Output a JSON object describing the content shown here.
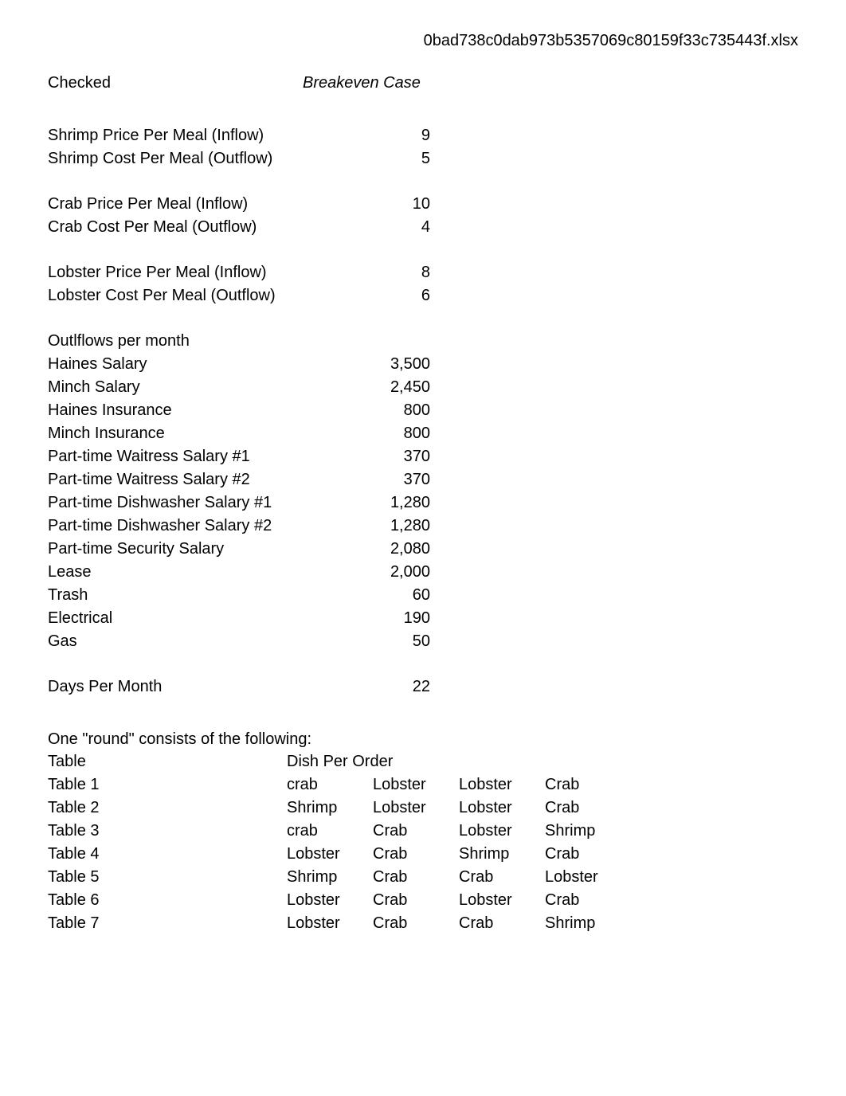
{
  "filename": "0bad738c0dab973b5357069c80159f33c735443f.xlsx",
  "checked_label": "Checked",
  "case_label": "Breakeven Case",
  "pricing_groups": [
    [
      {
        "label": "Shrimp Price Per Meal (Inflow)",
        "value": "9"
      },
      {
        "label": "Shrimp Cost Per Meal (Outflow)",
        "value": "5"
      }
    ],
    [
      {
        "label": "Crab Price Per Meal (Inflow)",
        "value": "10"
      },
      {
        "label": "Crab Cost Per Meal (Outflow)",
        "value": "4"
      }
    ],
    [
      {
        "label": "Lobster Price Per Meal (Inflow)",
        "value": "8"
      },
      {
        "label": "Lobster Cost Per Meal (Outflow)",
        "value": "6"
      }
    ]
  ],
  "outflows_title": "Outlflows per month",
  "outflows": [
    {
      "label": "Haines  Salary",
      "value": "3,500"
    },
    {
      "label": "Minch Salary",
      "value": "2,450"
    },
    {
      "label": "Haines Insurance",
      "value": "800"
    },
    {
      "label": "Minch Insurance",
      "value": "800"
    },
    {
      "label": "Part-time Waitress Salary #1",
      "value": "370"
    },
    {
      "label": "Part-time Waitress Salary #2",
      "value": "370"
    },
    {
      "label": "Part-time Dishwasher Salary #1",
      "value": "1,280"
    },
    {
      "label": "Part-time Dishwasher Salary #2",
      "value": "1,280"
    },
    {
      "label": "Part-time Security Salary",
      "value": "2,080"
    },
    {
      "label": "Lease",
      "value": "2,000"
    },
    {
      "label": "Trash",
      "value": "60"
    },
    {
      "label": "Electrical",
      "value": "190"
    },
    {
      "label": "Gas",
      "value": "50"
    }
  ],
  "days_per_month": {
    "label": "Days Per Month",
    "value": "22"
  },
  "round_title": "One \"round\" consists of the following:",
  "table_header": {
    "col1": "Table",
    "col2": "Dish Per Order"
  },
  "table_rows": [
    {
      "name": "Table 1",
      "dishes": [
        "crab",
        "Lobster",
        "Lobster",
        "Crab"
      ]
    },
    {
      "name": "Table 2",
      "dishes": [
        "Shrimp",
        "Lobster",
        "Lobster",
        "Crab"
      ]
    },
    {
      "name": "Table 3",
      "dishes": [
        "crab",
        "Crab",
        "Lobster",
        "Shrimp"
      ]
    },
    {
      "name": "Table 4",
      "dishes": [
        "Lobster",
        "Crab",
        "Shrimp",
        "Crab"
      ]
    },
    {
      "name": "Table 5",
      "dishes": [
        "Shrimp",
        "Crab",
        "Crab",
        "Lobster"
      ]
    },
    {
      "name": "Table 6",
      "dishes": [
        "Lobster",
        "Crab",
        "Lobster",
        "Crab"
      ]
    },
    {
      "name": "Table 7",
      "dishes": [
        "Lobster",
        "Crab",
        "Crab",
        "Shrimp"
      ]
    }
  ]
}
